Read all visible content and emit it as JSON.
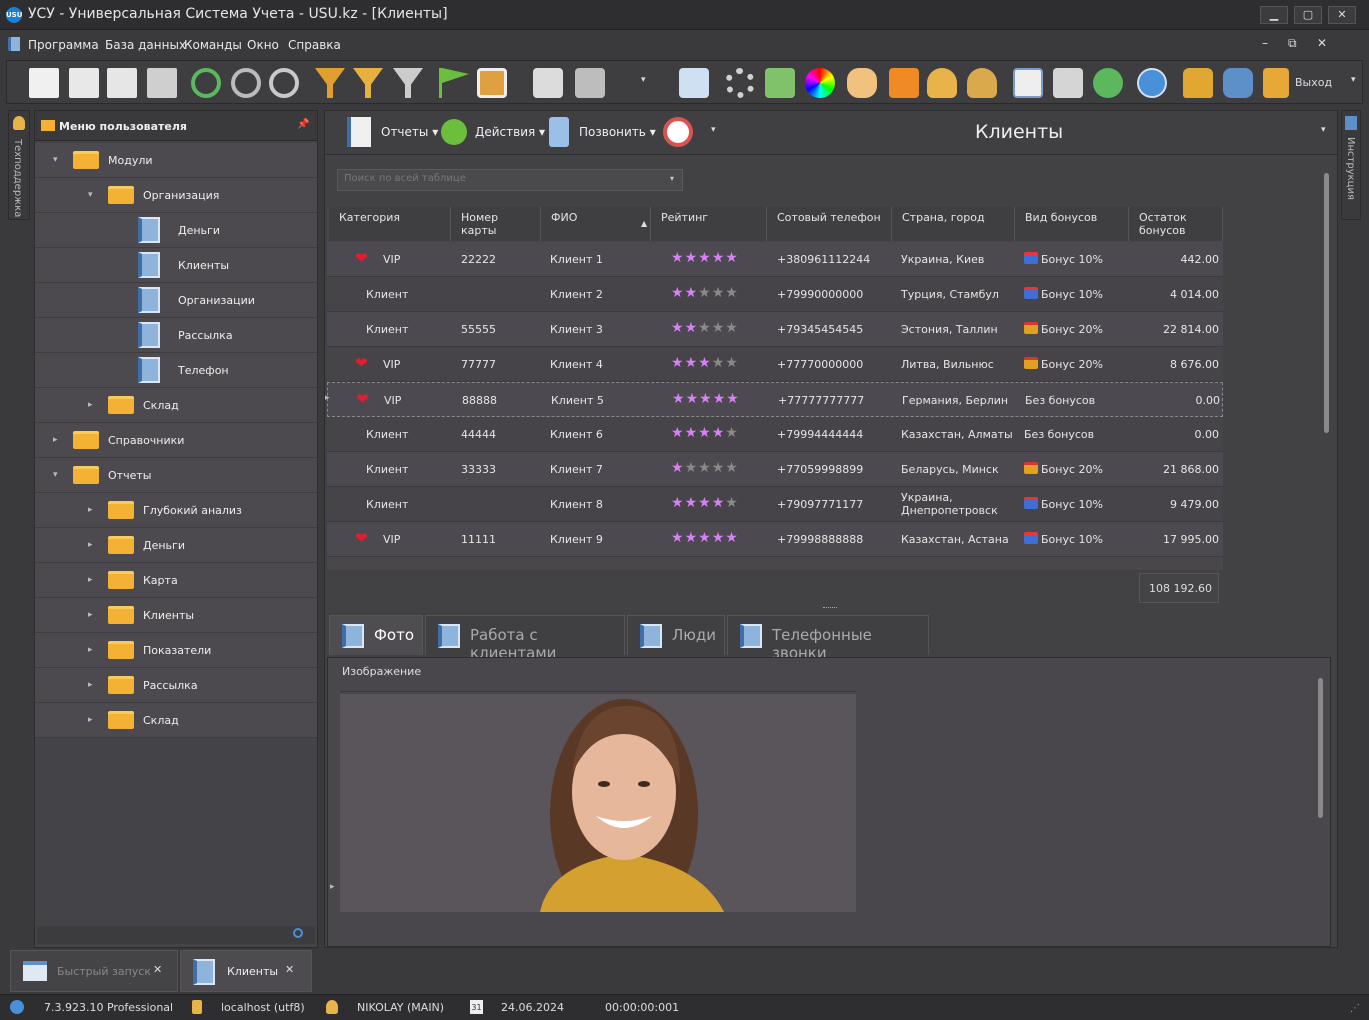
{
  "window": {
    "title": "УСУ - Универсальная Система Учета - USU.kz - [Клиенты]",
    "logo": "USU"
  },
  "menu": [
    "Программа",
    "База данных",
    "Команды",
    "Окно",
    "Справка"
  ],
  "toolbar": {
    "exit_label": "Выход"
  },
  "left_strip": {
    "label": "Техподдержка"
  },
  "right_strip": {
    "label": "Инструкция"
  },
  "sidebar": {
    "title": "Меню пользователя",
    "items": [
      {
        "label": "Модули",
        "level": 0,
        "type": "folder",
        "state": "open"
      },
      {
        "label": "Организация",
        "level": 1,
        "type": "folder",
        "state": "open"
      },
      {
        "label": "Деньги",
        "level": 2,
        "type": "book"
      },
      {
        "label": "Клиенты",
        "level": 2,
        "type": "book"
      },
      {
        "label": "Организации",
        "level": 2,
        "type": "book"
      },
      {
        "label": "Рассылка",
        "level": 2,
        "type": "book"
      },
      {
        "label": "Телефон",
        "level": 2,
        "type": "book"
      },
      {
        "label": "Склад",
        "level": 1,
        "type": "folder",
        "state": "closed"
      },
      {
        "label": "Справочники",
        "level": 0,
        "type": "folder",
        "state": "closed"
      },
      {
        "label": "Отчеты",
        "level": 0,
        "type": "folder",
        "state": "open"
      },
      {
        "label": "Глубокий анализ",
        "level": 1,
        "type": "folder",
        "state": "closed"
      },
      {
        "label": "Деньги",
        "level": 1,
        "type": "folder",
        "state": "closed"
      },
      {
        "label": "Карта",
        "level": 1,
        "type": "folder",
        "state": "closed"
      },
      {
        "label": "Клиенты",
        "level": 1,
        "type": "folder",
        "state": "closed"
      },
      {
        "label": "Показатели",
        "level": 1,
        "type": "folder",
        "state": "closed"
      },
      {
        "label": "Рассылка",
        "level": 1,
        "type": "folder",
        "state": "closed"
      },
      {
        "label": "Склад",
        "level": 1,
        "type": "folder",
        "state": "closed"
      }
    ]
  },
  "main": {
    "buttons": {
      "reports": "Отчеты",
      "actions": "Действия",
      "call": "Позвонить"
    },
    "title": "Клиенты",
    "filter_placeholder": "Поиск по всей таблице",
    "columns": [
      "Категория",
      "Номер карты",
      "ФИО",
      "Рейтинг",
      "Сотовый телефон",
      "Страна, город",
      "Вид бонусов",
      "Остаток бонусов"
    ],
    "rows": [
      {
        "vip": true,
        "category": "VIP",
        "card": "22222",
        "name": "Клиент 1",
        "rating": 5,
        "phone": "+380961112244",
        "city": "Украина, Киев",
        "bonus": "Бонус 10%",
        "bonus_icon": "blue",
        "balance": "442.00"
      },
      {
        "vip": false,
        "category": "Клиент",
        "card": "",
        "name": "Клиент 2",
        "rating": 2,
        "phone": "+79990000000",
        "city": "Турция, Стамбул",
        "bonus": "Бонус 10%",
        "bonus_icon": "blue",
        "balance": "4 014.00"
      },
      {
        "vip": false,
        "category": "Клиент",
        "card": "55555",
        "name": "Клиент 3",
        "rating": 2,
        "phone": "+79345454545",
        "city": "Эстония, Таллин",
        "bonus": "Бонус 20%",
        "bonus_icon": "gold",
        "balance": "22 814.00"
      },
      {
        "vip": true,
        "category": "VIP",
        "card": "77777",
        "name": "Клиент 4",
        "rating": 3,
        "phone": "+77770000000",
        "city": "Литва, Вильнюс",
        "bonus": "Бонус 20%",
        "bonus_icon": "gold",
        "balance": "8 676.00"
      },
      {
        "vip": true,
        "category": "VIP",
        "card": "88888",
        "name": "Клиент 5",
        "rating": 5,
        "phone": "+77777777777",
        "city": "Германия, Берлин",
        "bonus": "Без бонусов",
        "bonus_icon": "",
        "balance": "0.00",
        "selected": true
      },
      {
        "vip": false,
        "category": "Клиент",
        "card": "44444",
        "name": "Клиент 6",
        "rating": 4,
        "phone": "+79994444444",
        "city": "Казахстан, Алматы",
        "bonus": "Без бонусов",
        "bonus_icon": "",
        "balance": "0.00"
      },
      {
        "vip": false,
        "category": "Клиент",
        "card": "33333",
        "name": "Клиент 7",
        "rating": 1,
        "phone": "+77059998899",
        "city": "Беларусь, Минск",
        "bonus": "Бонус 20%",
        "bonus_icon": "gold",
        "balance": "21 868.00"
      },
      {
        "vip": false,
        "category": "Клиент",
        "card": "",
        "name": "Клиент 8",
        "rating": 4,
        "phone": "+79097771177",
        "city": "Украина, Днепропетровск",
        "bonus": "Бонус 10%",
        "bonus_icon": "blue",
        "balance": "9 479.00"
      },
      {
        "vip": true,
        "category": "VIP",
        "card": "11111",
        "name": "Клиент 9",
        "rating": 5,
        "phone": "+79998888888",
        "city": "Казахстан, Астана",
        "bonus": "Бонус 10%",
        "bonus_icon": "blue",
        "balance": "17 995.00"
      }
    ],
    "total": "108 192.60",
    "tabs": [
      "Фото",
      "Работа с клиентами",
      "Люди",
      "Телефонные звонки"
    ],
    "detail_label": "Изображение"
  },
  "bottom_tabs": [
    {
      "label": "Быстрый запуск"
    },
    {
      "label": "Клиенты"
    }
  ],
  "status": {
    "version": "7.3.923.10 Professional",
    "db": "localhost (utf8)",
    "user": "NIKOLAY (MAIN)",
    "date": "24.06.2024",
    "timer": "00:00:00:001",
    "calendar_day": "31"
  },
  "colors": {
    "accent_star": "#d682f5",
    "heart": "#e21d2d",
    "folder": "#f3b234"
  }
}
